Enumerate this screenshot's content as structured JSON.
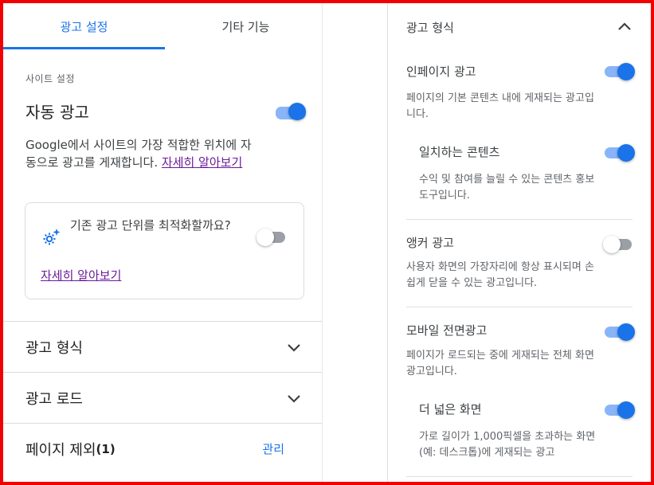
{
  "tabs": [
    {
      "label": "광고 설정",
      "active": true
    },
    {
      "label": "기타 기능",
      "active": false
    }
  ],
  "site_settings": {
    "section_label": "사이트 설정",
    "auto_ads_title": "자동 광고",
    "auto_ads_enabled": true,
    "auto_ads_desc": "Google에서 사이트의 가장 적합한 위치에 자동으로 광고를 게재합니다.",
    "learn_more": "자세히 알아보기"
  },
  "optimize_card": {
    "icon": "sparkle-gear-icon",
    "text": "기존 광고 단위를 최적화할까요?",
    "enabled": false,
    "learn_more": "자세히 알아보기"
  },
  "sections": [
    {
      "label": "광고 형식",
      "icon": "chevron-down-icon"
    },
    {
      "label": "광고 로드",
      "icon": "chevron-down-icon"
    }
  ],
  "page_exclusion": {
    "label": "페이지 제외",
    "count": "(1)",
    "manage": "관리"
  },
  "right_panel": {
    "header": "광고 형식",
    "header_icon": "chevron-up-icon",
    "items": [
      {
        "title": "인페이지 광고",
        "desc": "페이지의 기본 콘텐츠 내에 게재되는 광고입니다.",
        "enabled": true
      },
      {
        "title": "일치하는 콘텐츠",
        "desc": "수익 및 참여를 늘릴 수 있는 콘텐츠 홍보 도구입니다.",
        "enabled": true
      },
      {
        "title": "앵커 광고",
        "desc": "사용자 화면의 가장자리에 항상 표시되며 손쉽게 닫을 수 있는 광고입니다.",
        "enabled": false
      },
      {
        "title": "모바일 전면광고",
        "desc": "페이지가 로드되는 중에 게재되는 전체 화면 광고입니다.",
        "enabled": true
      },
      {
        "title": "더 넓은 화면",
        "desc": "가로 길이가 1,000픽셀을 초과하는 화면(예: 데스크톱)에 게재되는 광고",
        "enabled": true
      }
    ]
  },
  "colors": {
    "accent": "#1a73e8",
    "link_visited": "#6a1b9a",
    "frame": "#f20000"
  }
}
